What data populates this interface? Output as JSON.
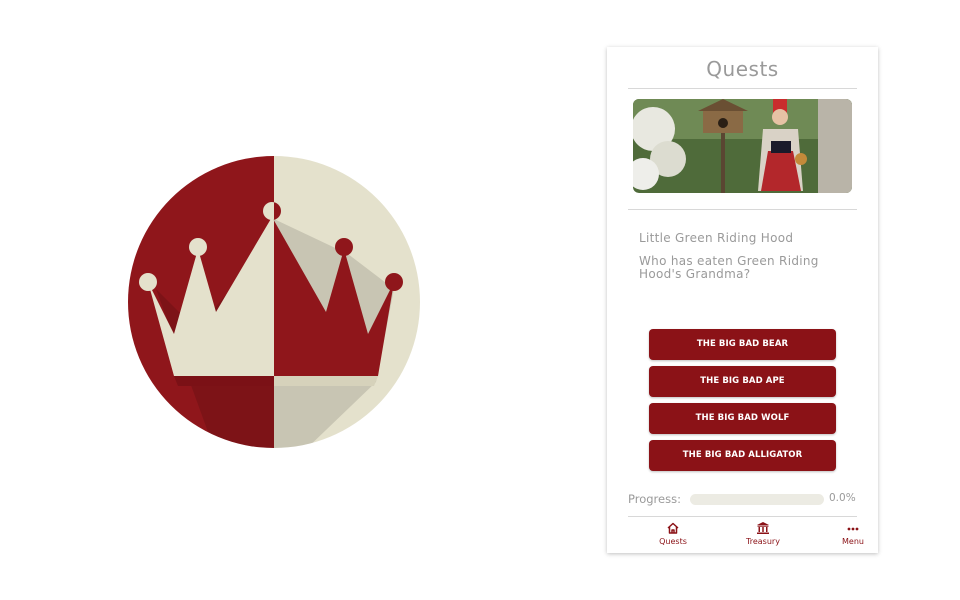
{
  "app_icon": {
    "icon": "crown-icon",
    "colors": {
      "red": "#8f161b",
      "cream": "#e4e1cc"
    }
  },
  "screen": {
    "title": "Quests",
    "hero_image": {
      "description_icon": "quest-illustration"
    },
    "quest": {
      "name": "Little Green Riding Hood",
      "question": "Who has eaten Green Riding Hood's Grandma?"
    },
    "answers": [
      {
        "label": "THE BIG BAD BEAR"
      },
      {
        "label": "THE BIG BAD APE"
      },
      {
        "label": "THE BIG BAD WOLF"
      },
      {
        "label": "THE BIG BAD ALLIGATOR"
      }
    ],
    "progress": {
      "label": "Progress:",
      "value_text": "0.0%",
      "fraction": 0.0
    },
    "nav": [
      {
        "label": "Quests",
        "icon": "home-icon"
      },
      {
        "label": "Treasury",
        "icon": "bank-icon"
      },
      {
        "label": "Menu",
        "icon": "more-icon"
      }
    ]
  },
  "colors": {
    "accent": "#8b1217",
    "text_muted": "#9a9a9a",
    "track": "#ecebe3"
  }
}
